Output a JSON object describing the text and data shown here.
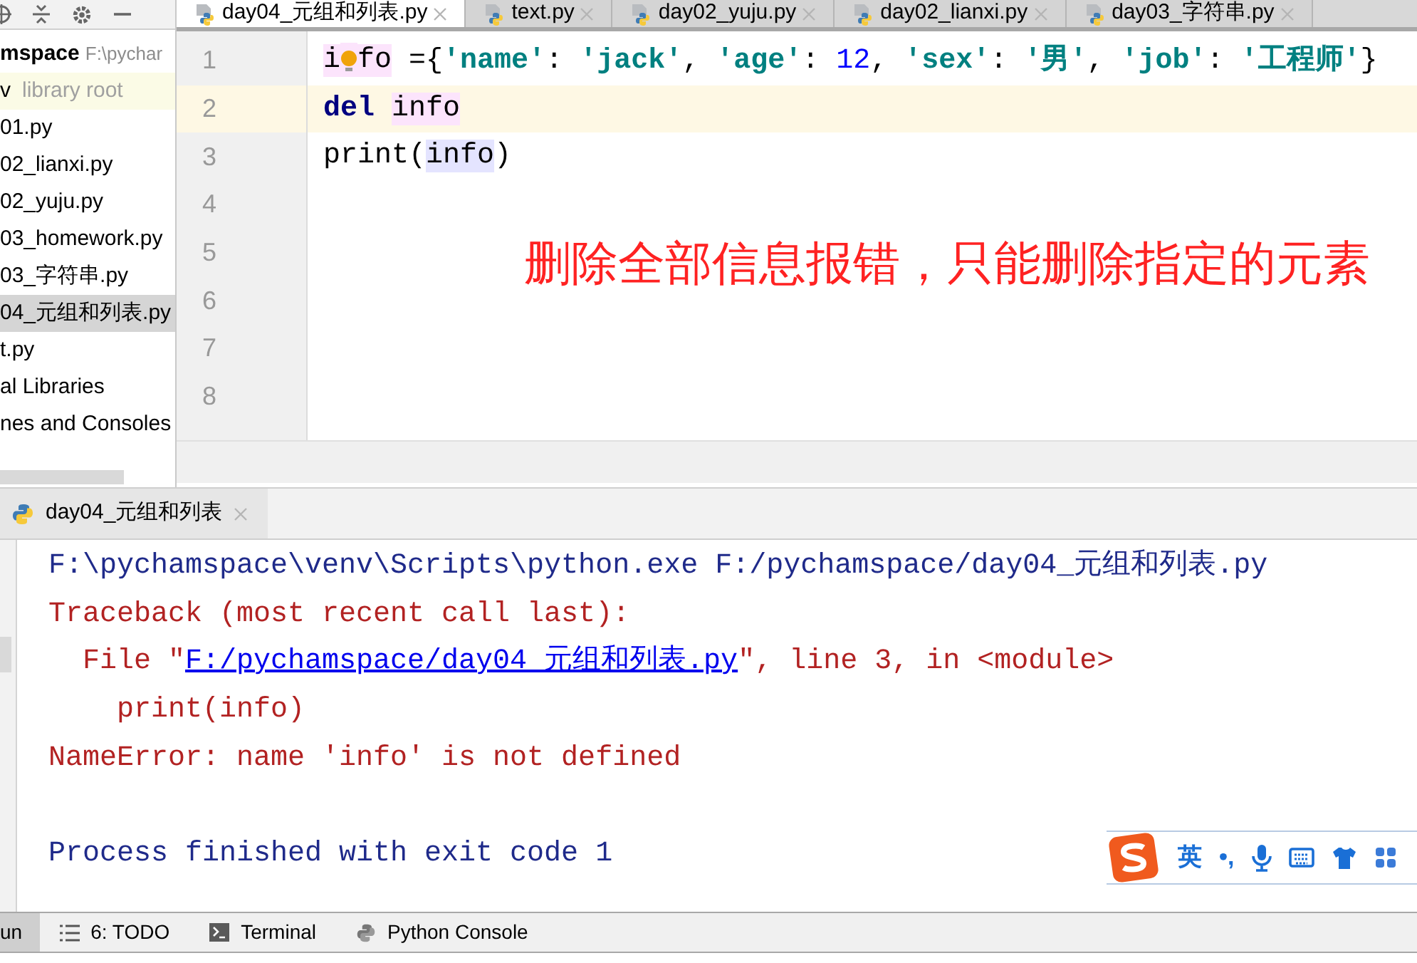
{
  "project_panel": {
    "root": {
      "name": "mspace",
      "path": "F:\\pychar"
    },
    "venv": {
      "name": "v",
      "hint": "library root"
    },
    "items": [
      {
        "label": "01.py",
        "selected": false
      },
      {
        "label": "02_lianxi.py",
        "selected": false
      },
      {
        "label": "02_yuju.py",
        "selected": false
      },
      {
        "label": "03_homework.py",
        "selected": false
      },
      {
        "label": "03_字符串.py",
        "selected": false
      },
      {
        "label": "04_元组和列表.py",
        "selected": true
      },
      {
        "label": "t.py",
        "selected": false
      },
      {
        "label": "al Libraries",
        "selected": false
      },
      {
        "label": "nes and Consoles",
        "selected": false
      }
    ]
  },
  "editor_tabs": [
    {
      "label": "day04_元组和列表.py",
      "selected": true
    },
    {
      "label": "text.py",
      "selected": false
    },
    {
      "label": "day02_yuju.py",
      "selected": false
    },
    {
      "label": "day02_lianxi.py",
      "selected": false
    },
    {
      "label": "day03_字符串.py",
      "selected": false
    }
  ],
  "editor": {
    "lines": [
      {
        "number": "1",
        "current": false,
        "intention_bulb": true,
        "tokens": [
          {
            "kind": "ref",
            "text": "i"
          },
          {
            "kind": "ref",
            "text": "fo"
          },
          {
            "kind": "plain",
            "text": " ={"
          },
          {
            "kind": "string",
            "text": "'name'"
          },
          {
            "kind": "plain",
            "text": ": "
          },
          {
            "kind": "string",
            "text": "'jack'"
          },
          {
            "kind": "plain",
            "text": ", "
          },
          {
            "kind": "string",
            "text": "'age'"
          },
          {
            "kind": "plain",
            "text": ": "
          },
          {
            "kind": "number",
            "text": "12"
          },
          {
            "kind": "plain",
            "text": ", "
          },
          {
            "kind": "string",
            "text": "'sex'"
          },
          {
            "kind": "plain",
            "text": ": "
          },
          {
            "kind": "string",
            "text": "'男'"
          },
          {
            "kind": "plain",
            "text": ", "
          },
          {
            "kind": "string",
            "text": "'job'"
          },
          {
            "kind": "plain",
            "text": ": "
          },
          {
            "kind": "string",
            "text": "'工程师'"
          },
          {
            "kind": "plain",
            "text": "}"
          }
        ]
      },
      {
        "number": "2",
        "current": true,
        "tokens": [
          {
            "kind": "keyword",
            "text": "del "
          },
          {
            "kind": "ref",
            "text": "info"
          }
        ]
      },
      {
        "number": "3",
        "current": false,
        "tokens": [
          {
            "kind": "plain",
            "text": "print("
          },
          {
            "kind": "usage",
            "text": "info"
          },
          {
            "kind": "plain",
            "text": ")"
          }
        ]
      },
      {
        "number": "4",
        "current": false
      },
      {
        "number": "5",
        "current": false
      },
      {
        "number": "6",
        "current": false
      },
      {
        "number": "7",
        "current": false
      },
      {
        "number": "8",
        "current": false
      }
    ],
    "annotation": "删除全部信息报错，只能删除指定的元素"
  },
  "run_panel": {
    "tab": {
      "label": "day04_元组和列表"
    },
    "console": [
      {
        "kind": "command",
        "parts": [
          {
            "kind": "text",
            "text": "F:\\pychamspace\\venv\\Scripts\\python.exe F:/pychamspace/day04_元组和列表.py"
          }
        ]
      },
      {
        "kind": "error",
        "parts": [
          {
            "kind": "text",
            "text": "Traceback (most recent call last):"
          }
        ]
      },
      {
        "kind": "error",
        "parts": [
          {
            "kind": "text",
            "text": "  File \""
          },
          {
            "kind": "link",
            "text": "F:/pychamspace/day04_元组和列表.py"
          },
          {
            "kind": "text",
            "text": "\", line 3, in <module>"
          }
        ]
      },
      {
        "kind": "error",
        "parts": [
          {
            "kind": "text",
            "text": "    print(info)"
          }
        ]
      },
      {
        "kind": "error",
        "parts": [
          {
            "kind": "text",
            "text": "NameError: name 'info' is not defined"
          }
        ]
      },
      {
        "kind": "exit",
        "parts": [
          {
            "kind": "text",
            "text": "Process finished with exit code 1"
          }
        ]
      }
    ]
  },
  "bottom_tabs": [
    {
      "kind": "run",
      "label": "un",
      "selected": true
    },
    {
      "kind": "todo",
      "label": "6: TODO",
      "selected": false
    },
    {
      "kind": "terminal",
      "label": "Terminal",
      "selected": false
    },
    {
      "kind": "python",
      "label": "Python Console",
      "selected": false
    }
  ],
  "ime_bar": {
    "mode": "英",
    "punctuation": "•,"
  }
}
